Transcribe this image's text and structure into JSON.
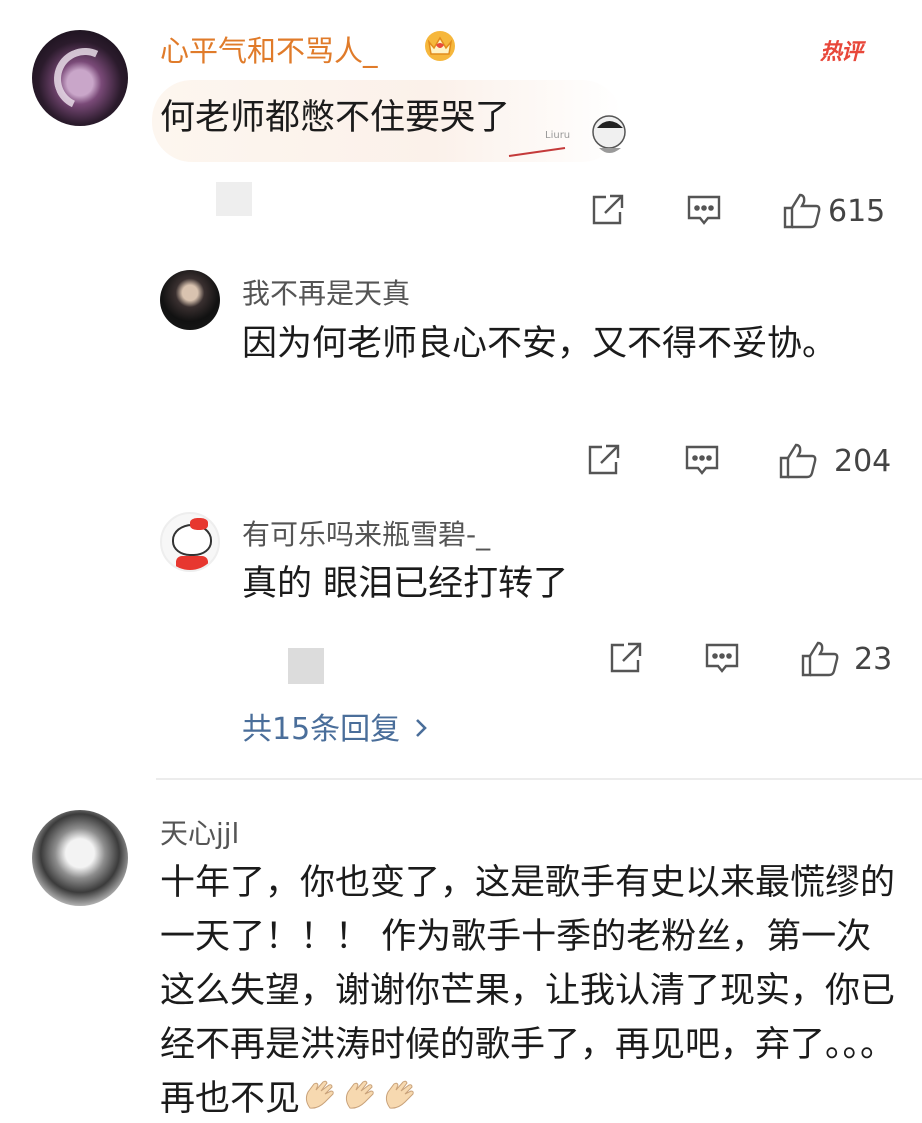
{
  "comments": [
    {
      "user": "心平气和不骂人_",
      "badge": "热评",
      "text": "何老师都憋不住要哭了",
      "likes": "615",
      "replies": [
        {
          "user": "我不再是天真",
          "text": "因为何老师良心不安，又不得不妥协。",
          "likes": "204"
        },
        {
          "user": "有可乐吗来瓶雪碧-_",
          "text": "真的 眼泪已经打转了",
          "likes": "23"
        }
      ],
      "more_replies": "共15条回复"
    },
    {
      "user": "天心jjl",
      "text": "十年了，你也变了，这是歌手有史以来最慌缪的一天了！！！ 作为歌手十季的老粉丝，第一次这么失望，谢谢你芒果，让我认清了现实，你已经不再是洪涛时候的歌手了，再见吧，弃了。。。再也不见"
    }
  ],
  "colors": {
    "vip_name": "#e07b2a",
    "hot_badge": "#e8473a",
    "link": "#4a6e9a",
    "text": "#1b1b1b"
  },
  "icons": [
    "crown-icon",
    "share-icon",
    "comment-icon",
    "like-icon",
    "chevron-right-icon",
    "clap-icon"
  ]
}
